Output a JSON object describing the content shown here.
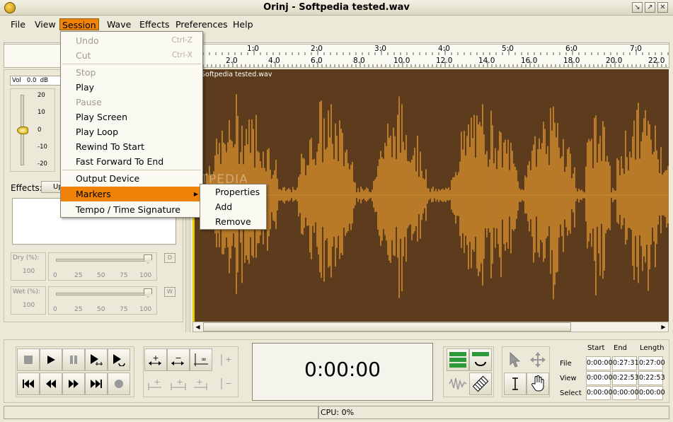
{
  "window": {
    "title": "Orinj - Softpedia tested.wav"
  },
  "menubar": [
    {
      "label": "File"
    },
    {
      "label": "View"
    },
    {
      "label": "Session"
    },
    {
      "label": "Wave"
    },
    {
      "label": "Effects"
    },
    {
      "label": "Preferences"
    },
    {
      "label": "Help"
    }
  ],
  "session_menu": {
    "undo": {
      "label": "Undo",
      "shortcut": "Ctrl-Z"
    },
    "cut": {
      "label": "Cut",
      "shortcut": "Ctrl-X"
    },
    "stop": "Stop",
    "play": "Play",
    "pause": "Pause",
    "play_screen": "Play Screen",
    "play_loop": "Play Loop",
    "rewind": "Rewind To Start",
    "fast_forward": "Fast Forward To End",
    "output_device": "Output Device",
    "markers": "Markers",
    "tempo": "Tempo / Time Signature"
  },
  "markers_submenu": [
    "Properties",
    "Add",
    "Remove"
  ],
  "ruler": {
    "top": [
      "1:0",
      "2:0",
      "3:0",
      "4:0",
      "5:0",
      "6:0",
      "7:0"
    ],
    "bottom": [
      "2.0",
      "4.0",
      "6.0",
      "8.0",
      "10.0",
      "12.0",
      "14.0",
      "16.0",
      "18.0",
      "20.0",
      "22.0"
    ]
  },
  "track": {
    "name": "Softpedia tested.wav"
  },
  "volume": {
    "label": "Vol",
    "value": "0.0",
    "unit": "dB",
    "scale": [
      "20",
      "10",
      "0",
      "-10",
      "-20"
    ]
  },
  "effects": {
    "label": "Effects:",
    "up_button": "Up"
  },
  "dry": {
    "label": "Dry (%):",
    "value": "100",
    "button": "D",
    "scale": [
      "0",
      "25",
      "50",
      "75",
      "100"
    ]
  },
  "wet": {
    "label": "Wet (%):",
    "value": "100",
    "button": "W",
    "scale": [
      "0",
      "25",
      "50",
      "75",
      "100"
    ]
  },
  "time_display": "0:00:00",
  "position_table": {
    "headers": [
      "Start",
      "End",
      "Length"
    ],
    "rows": [
      {
        "label": "File",
        "start": "0:00:00",
        "end": "0:27:31",
        "length": "0:27:00"
      },
      {
        "label": "View",
        "start": "0:00:00",
        "end": "0:22:53",
        "length": "0:22:53"
      },
      {
        "label": "Select",
        "start": "0:00:00",
        "end": "0:00:00",
        "length": "0:00:00"
      }
    ]
  },
  "status": {
    "cpu": "CPU: 0%"
  },
  "watermark": "SOFTPEDIA",
  "colors": {
    "accent_orange": "#f0820a",
    "waveform": "#d08a2c",
    "waveform_bg": "#5c3c1c"
  }
}
